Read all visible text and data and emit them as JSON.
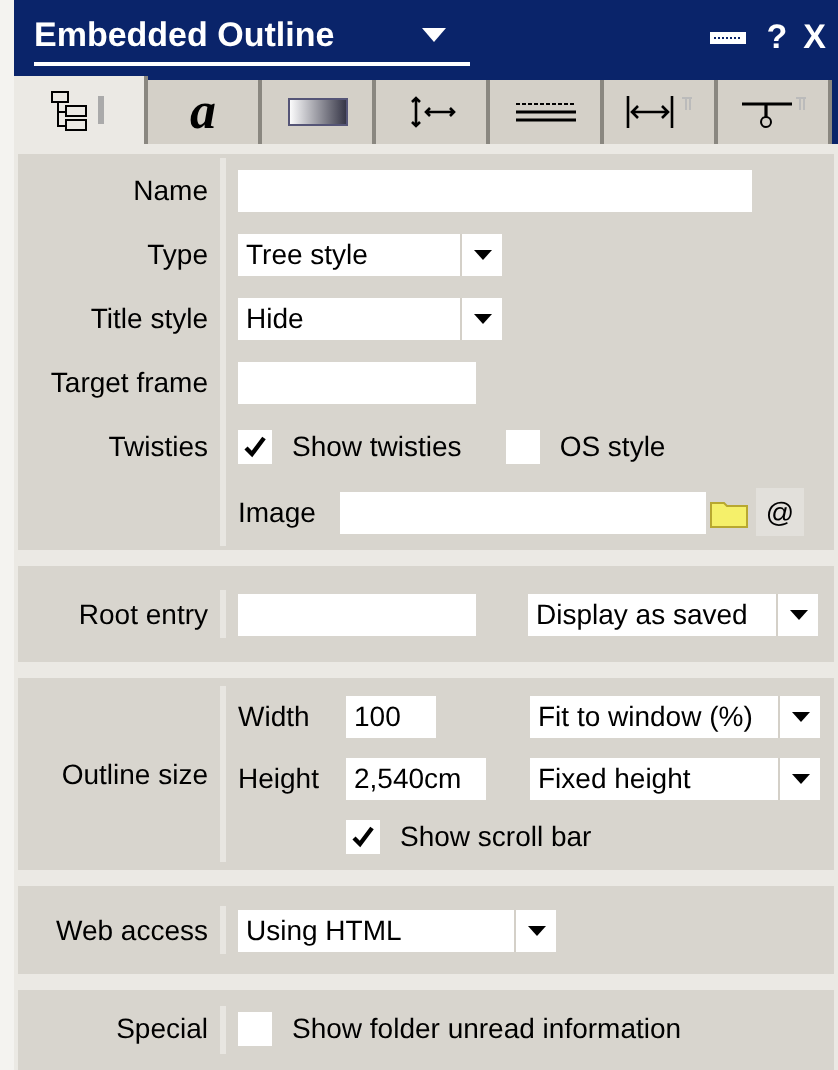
{
  "window": {
    "title": "Embedded Outline",
    "help": "?",
    "close": "X"
  },
  "tabs": [
    {
      "selected": true
    },
    {
      "label": "a",
      "selected": false
    },
    {
      "selected": false
    },
    {
      "selected": false
    },
    {
      "selected": false
    },
    {
      "selected": false
    },
    {
      "selected": false
    }
  ],
  "general": {
    "name": {
      "label": "Name"
    },
    "type": {
      "label": "Type",
      "value": "Tree style"
    },
    "title_style": {
      "label": "Title style",
      "value": "Hide"
    },
    "target_frame": {
      "label": "Target frame"
    },
    "twisties": {
      "label": "Twisties",
      "options": [
        {
          "label": "Show twisties",
          "checked": true
        },
        {
          "label": "OS style",
          "checked": false
        }
      ]
    },
    "image": {
      "label": "Image",
      "at": "@"
    }
  },
  "root_entry": {
    "label": "Root entry",
    "display": "Display as saved"
  },
  "outline_size": {
    "label": "Outline size",
    "width": {
      "label": "Width",
      "value": "100",
      "mode": "Fit to window (%)"
    },
    "height": {
      "label": "Height",
      "value": "2,540cm",
      "mode": "Fixed height"
    },
    "scroll_bar": {
      "label": "Show scroll bar",
      "checked": true
    }
  },
  "web_access": {
    "label": "Web access",
    "value": "Using HTML"
  },
  "special": {
    "label": "Special",
    "option": {
      "label": "Show folder unread information",
      "checked": false
    }
  }
}
